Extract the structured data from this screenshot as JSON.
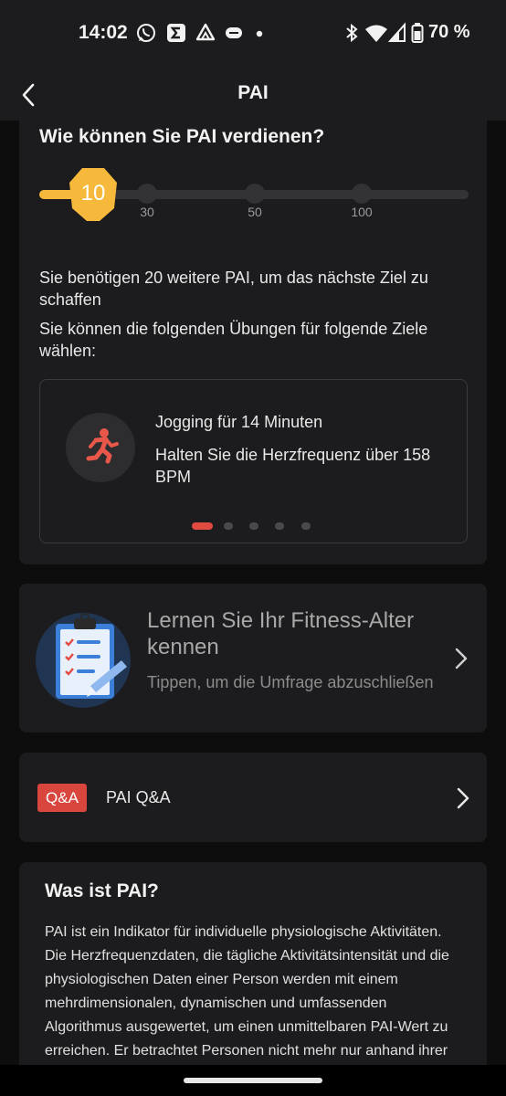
{
  "status_bar": {
    "time": "14:02",
    "left_icons": [
      "whatsapp-icon",
      "sigma-icon",
      "drive-icon",
      "pill-icon",
      "dot-icon"
    ],
    "right_icons": [
      "bluetooth-icon",
      "wifi-icon",
      "signal-icon",
      "battery-icon"
    ],
    "battery": "70 %"
  },
  "header": {
    "title": "PAI",
    "back_icon": "chevron-left-icon"
  },
  "earn": {
    "title": "Wie können Sie PAI verdienen?",
    "current_value": "10",
    "current_fraction": 0.06,
    "milestones": [
      "30",
      "50",
      "100"
    ],
    "progress_color": "#f6b93b",
    "info_1": "Sie benötigen 20 weitere PAI, um das nächste Ziel zu schaffen",
    "info_2": "Sie können die folgenden Übungen für folgende Ziele wählen:",
    "exercise": {
      "icon": "running-icon",
      "name": "Jogging für 14 Minuten",
      "description": "Halten Sie die Herzfrequenz über 158 BPM"
    },
    "pager": {
      "count": 5,
      "active_index": 0,
      "active_color": "#e04a3f"
    }
  },
  "fitness": {
    "icon": "clipboard-checklist-icon",
    "title": "Lernen Sie Ihr Fitness-Alter kennen",
    "subtitle": "Tippen, um die Umfrage abzuschließen"
  },
  "qa": {
    "badge": "Q&A",
    "label": "PAI Q&A",
    "badge_color": "#d9463d"
  },
  "what": {
    "title": "Was ist PAI?",
    "body": "PAI ist ein Indikator für individuelle physiologische Aktivitäten. Die Herzfrequenzdaten, die tägliche Aktivitätsintensität und die physiologischen Daten einer Person werden mit einem mehrdimensionalen, dynamischen und umfassenden Algorithmus ausgewertet, um einen unmittelbaren PAI-Wert zu erreichen. Er betrachtet Personen nicht mehr nur anhand ihrer Schrittzahl und ihrer"
  }
}
